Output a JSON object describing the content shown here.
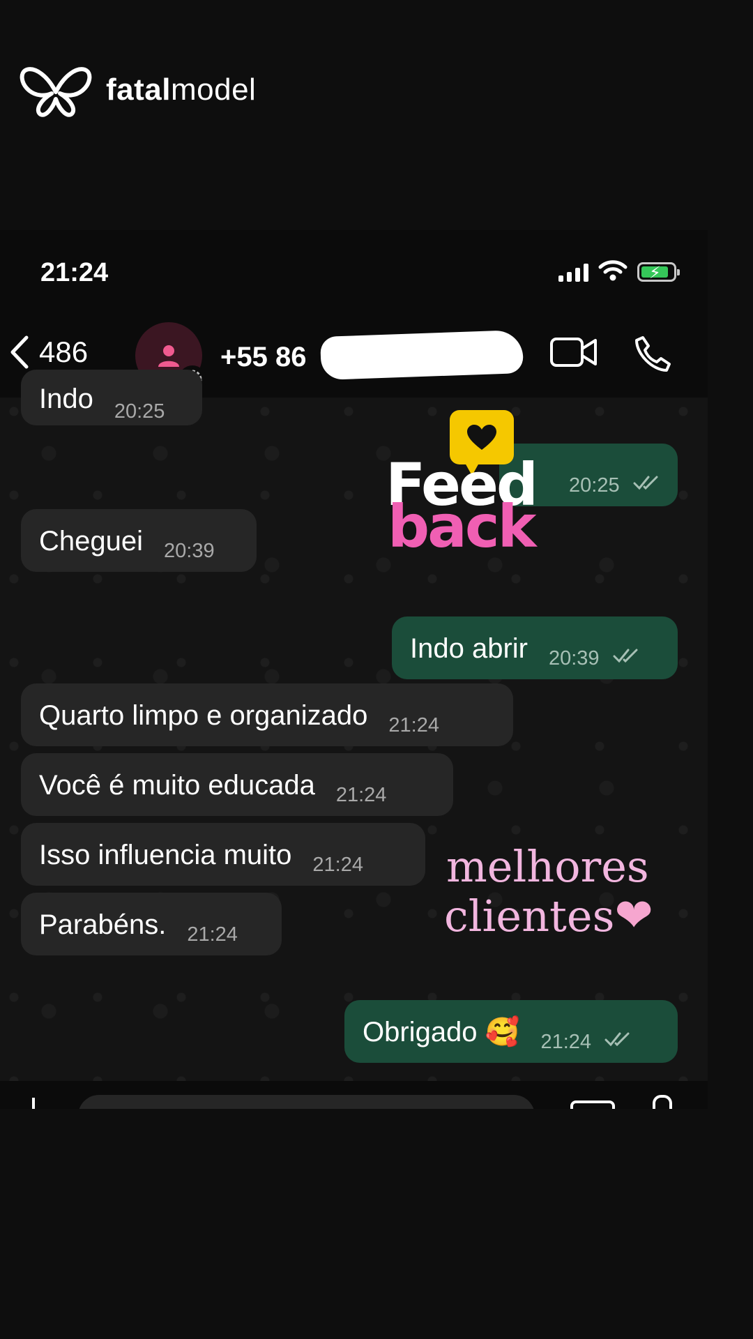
{
  "brand": {
    "name_bold": "fatal",
    "name_rest": "model"
  },
  "status_bar": {
    "time": "21:24"
  },
  "chat_header": {
    "back_count": "486",
    "contact": "+55 86"
  },
  "messages": [
    {
      "dir": "in",
      "text": "Indo",
      "time": "20:25",
      "partial": true
    },
    {
      "dir": "out",
      "text": "",
      "time": "20:25"
    },
    {
      "dir": "in",
      "text": "Cheguei",
      "time": "20:39"
    },
    {
      "dir": "out",
      "text": "Indo abrir",
      "time": "20:39"
    },
    {
      "dir": "in",
      "text": "Quarto limpo e organizado",
      "time": "21:24"
    },
    {
      "dir": "in",
      "text": "Você é muito educada",
      "time": "21:24"
    },
    {
      "dir": "in",
      "text": "Isso influencia muito",
      "time": "21:24"
    },
    {
      "dir": "in",
      "text": "Parabéns.",
      "time": "21:24"
    },
    {
      "dir": "out",
      "text": "Obrigado 🥰",
      "time": "21:24"
    }
  ],
  "stickers": {
    "feedback_line1": "Feed",
    "feedback_line2": "back",
    "script_line1": "melhores",
    "script_line2": "clientes"
  },
  "colors": {
    "incoming_bubble": "#262626",
    "outgoing_bubble": "#1b4d3a",
    "feedback_yellow": "#f5c800",
    "feedback_pink": "#f05fb3",
    "script_pink": "#f2b6df"
  }
}
